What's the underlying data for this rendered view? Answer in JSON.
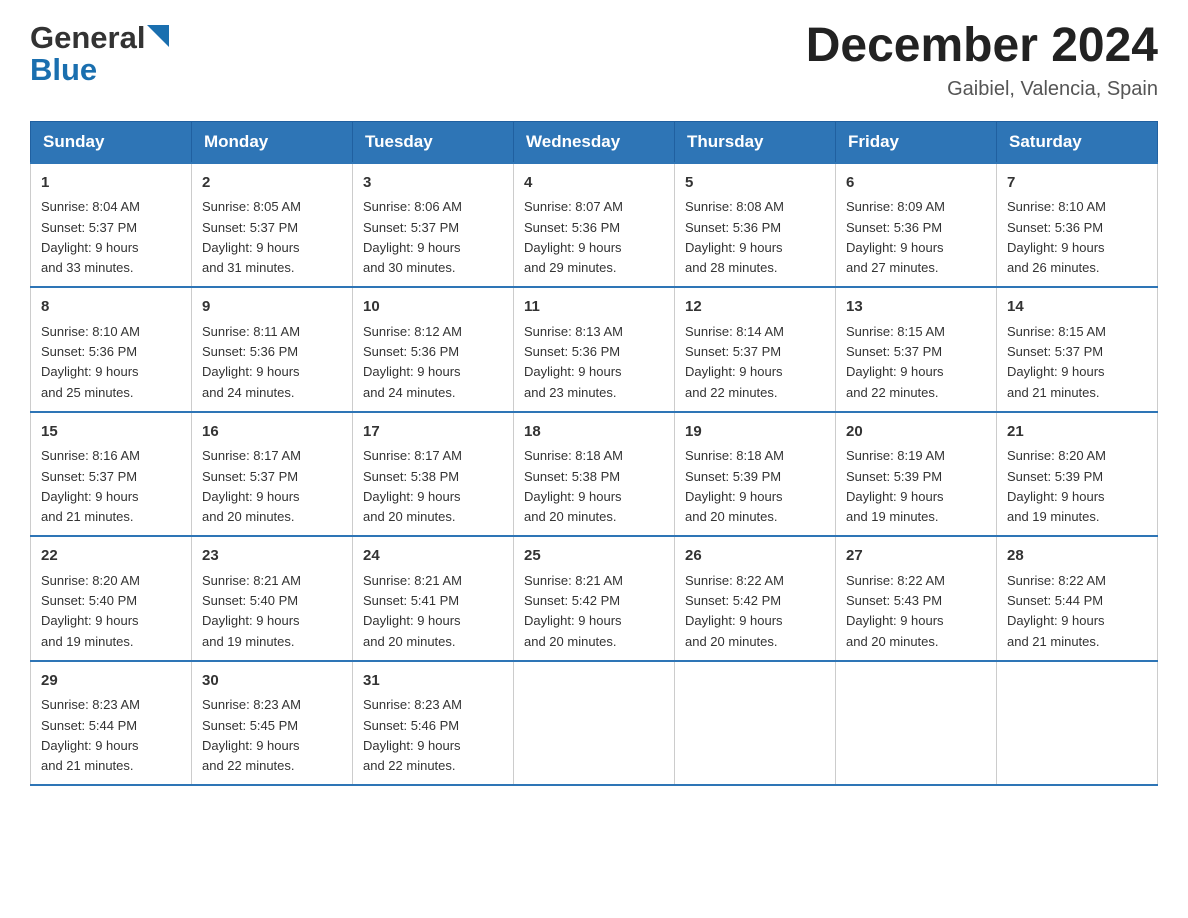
{
  "header": {
    "logo_general": "General",
    "logo_blue": "Blue",
    "month_title": "December 2024",
    "location": "Gaibiel, Valencia, Spain"
  },
  "days_of_week": [
    "Sunday",
    "Monday",
    "Tuesday",
    "Wednesday",
    "Thursday",
    "Friday",
    "Saturday"
  ],
  "weeks": [
    [
      {
        "day": "1",
        "sunrise": "8:04 AM",
        "sunset": "5:37 PM",
        "daylight": "9 hours and 33 minutes."
      },
      {
        "day": "2",
        "sunrise": "8:05 AM",
        "sunset": "5:37 PM",
        "daylight": "9 hours and 31 minutes."
      },
      {
        "day": "3",
        "sunrise": "8:06 AM",
        "sunset": "5:37 PM",
        "daylight": "9 hours and 30 minutes."
      },
      {
        "day": "4",
        "sunrise": "8:07 AM",
        "sunset": "5:36 PM",
        "daylight": "9 hours and 29 minutes."
      },
      {
        "day": "5",
        "sunrise": "8:08 AM",
        "sunset": "5:36 PM",
        "daylight": "9 hours and 28 minutes."
      },
      {
        "day": "6",
        "sunrise": "8:09 AM",
        "sunset": "5:36 PM",
        "daylight": "9 hours and 27 minutes."
      },
      {
        "day": "7",
        "sunrise": "8:10 AM",
        "sunset": "5:36 PM",
        "daylight": "9 hours and 26 minutes."
      }
    ],
    [
      {
        "day": "8",
        "sunrise": "8:10 AM",
        "sunset": "5:36 PM",
        "daylight": "9 hours and 25 minutes."
      },
      {
        "day": "9",
        "sunrise": "8:11 AM",
        "sunset": "5:36 PM",
        "daylight": "9 hours and 24 minutes."
      },
      {
        "day": "10",
        "sunrise": "8:12 AM",
        "sunset": "5:36 PM",
        "daylight": "9 hours and 24 minutes."
      },
      {
        "day": "11",
        "sunrise": "8:13 AM",
        "sunset": "5:36 PM",
        "daylight": "9 hours and 23 minutes."
      },
      {
        "day": "12",
        "sunrise": "8:14 AM",
        "sunset": "5:37 PM",
        "daylight": "9 hours and 22 minutes."
      },
      {
        "day": "13",
        "sunrise": "8:15 AM",
        "sunset": "5:37 PM",
        "daylight": "9 hours and 22 minutes."
      },
      {
        "day": "14",
        "sunrise": "8:15 AM",
        "sunset": "5:37 PM",
        "daylight": "9 hours and 21 minutes."
      }
    ],
    [
      {
        "day": "15",
        "sunrise": "8:16 AM",
        "sunset": "5:37 PM",
        "daylight": "9 hours and 21 minutes."
      },
      {
        "day": "16",
        "sunrise": "8:17 AM",
        "sunset": "5:37 PM",
        "daylight": "9 hours and 20 minutes."
      },
      {
        "day": "17",
        "sunrise": "8:17 AM",
        "sunset": "5:38 PM",
        "daylight": "9 hours and 20 minutes."
      },
      {
        "day": "18",
        "sunrise": "8:18 AM",
        "sunset": "5:38 PM",
        "daylight": "9 hours and 20 minutes."
      },
      {
        "day": "19",
        "sunrise": "8:18 AM",
        "sunset": "5:39 PM",
        "daylight": "9 hours and 20 minutes."
      },
      {
        "day": "20",
        "sunrise": "8:19 AM",
        "sunset": "5:39 PM",
        "daylight": "9 hours and 19 minutes."
      },
      {
        "day": "21",
        "sunrise": "8:20 AM",
        "sunset": "5:39 PM",
        "daylight": "9 hours and 19 minutes."
      }
    ],
    [
      {
        "day": "22",
        "sunrise": "8:20 AM",
        "sunset": "5:40 PM",
        "daylight": "9 hours and 19 minutes."
      },
      {
        "day": "23",
        "sunrise": "8:21 AM",
        "sunset": "5:40 PM",
        "daylight": "9 hours and 19 minutes."
      },
      {
        "day": "24",
        "sunrise": "8:21 AM",
        "sunset": "5:41 PM",
        "daylight": "9 hours and 20 minutes."
      },
      {
        "day": "25",
        "sunrise": "8:21 AM",
        "sunset": "5:42 PM",
        "daylight": "9 hours and 20 minutes."
      },
      {
        "day": "26",
        "sunrise": "8:22 AM",
        "sunset": "5:42 PM",
        "daylight": "9 hours and 20 minutes."
      },
      {
        "day": "27",
        "sunrise": "8:22 AM",
        "sunset": "5:43 PM",
        "daylight": "9 hours and 20 minutes."
      },
      {
        "day": "28",
        "sunrise": "8:22 AM",
        "sunset": "5:44 PM",
        "daylight": "9 hours and 21 minutes."
      }
    ],
    [
      {
        "day": "29",
        "sunrise": "8:23 AM",
        "sunset": "5:44 PM",
        "daylight": "9 hours and 21 minutes."
      },
      {
        "day": "30",
        "sunrise": "8:23 AM",
        "sunset": "5:45 PM",
        "daylight": "9 hours and 22 minutes."
      },
      {
        "day": "31",
        "sunrise": "8:23 AM",
        "sunset": "5:46 PM",
        "daylight": "9 hours and 22 minutes."
      },
      null,
      null,
      null,
      null
    ]
  ],
  "labels": {
    "sunrise": "Sunrise:",
    "sunset": "Sunset:",
    "daylight": "Daylight:"
  }
}
